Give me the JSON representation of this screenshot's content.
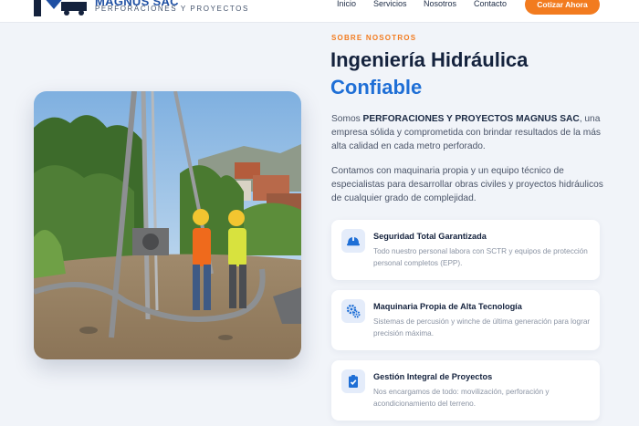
{
  "header": {
    "brand": "MAGNUS SAC",
    "brand_sub": "PERFORACIONES Y PROYECTOS",
    "nav": [
      "Inicio",
      "Servicios",
      "Nosotros",
      "Contacto"
    ],
    "cta": "Cotizar Ahora"
  },
  "about": {
    "eyebrow": "SOBRE NOSOTROS",
    "title_line1": "Ingeniería Hidráulica",
    "title_line2": "Confiable",
    "p1_prefix": "Somos ",
    "p1_company": "PERFORACIONES Y PROYECTOS MAGNUS SAC",
    "p1_suffix": ", una empresa sólida y comprometida con brindar resultados de la más alta calidad en cada metro perforado.",
    "p2": "Contamos con maquinaria propia y un equipo técnico de especialistas para desarrollar obras civiles y proyectos hidráulicos de cualquier grado de complejidad."
  },
  "features": [
    {
      "icon": "hard-hat-icon",
      "title": "Seguridad Total Garantizada",
      "desc": "Todo nuestro personal labora con SCTR y equipos de protección personal completos (EPP)."
    },
    {
      "icon": "gears-icon",
      "title": "Maquinaria Propia de Alta Tecnología",
      "desc": "Sistemas de percusión y winche de última generación para lograr precisión máxima."
    },
    {
      "icon": "clipboard-check-icon",
      "title": "Gestión Integral de Proyectos",
      "desc": "Nos encargamos de todo: movilización, perforación y acondicionamiento del terreno."
    }
  ],
  "colors": {
    "accent": "#f27b1f",
    "primary": "#1f6fd6",
    "navy": "#14223d"
  }
}
